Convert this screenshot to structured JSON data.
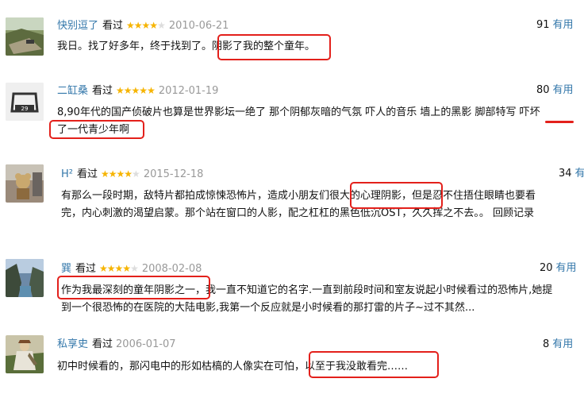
{
  "reviews": [
    {
      "user": "快别逗了",
      "watched": "看过",
      "rating": 4,
      "date": "2010-06-21",
      "useful_count": "91",
      "useful_label": "有用",
      "lines": [
        "我日。找了好多年，终于找到了。阴影了我的整个童年。"
      ]
    },
    {
      "user": "二缸桑",
      "watched": "看过",
      "rating": 5,
      "date": "2012-01-19",
      "useful_count": "80",
      "useful_label": "有用",
      "lines": [
        "8,90年代的国产侦破片也算是世界影坛一绝了 那个阴郁灰暗的气氛 吓人的音乐 墙上的黑影 脚部特写 吓坏",
        "了一代青少年啊"
      ],
      "avatar_badge": "29"
    },
    {
      "user": "H²",
      "watched": "看过",
      "rating": 4,
      "date": "2015-12-18",
      "useful_count": "34",
      "useful_label": "有",
      "lines": [
        "有那么一段时期，敌特片都拍成惊悚恐怖片，造成小朋友们很大的心理阴影，但是忍不住捂住眼睛也要看",
        "完，内心刺激的渴望启蒙。那个站在窗口的人影，配之杠杠的黑色低沉OST，久久挥之不去。。 回顾记录"
      ]
    },
    {
      "user": "巽",
      "watched": "看过",
      "rating": 4,
      "date": "2008-02-08",
      "useful_count": "20",
      "useful_label": "有用",
      "lines": [
        "作为我最深刻的童年阴影之一，我一直不知道它的名字.一直到前段时间和室友说起小时候看过的恐怖片,她提",
        "到一个很恐怖的在医院的大陆电影,我第一个反应就是小时候看的那打雷的片子~过不其然..."
      ]
    },
    {
      "user": "私享史",
      "watched": "看过",
      "rating": 0,
      "date": "2006-01-07",
      "useful_count": "8",
      "useful_label": "有用",
      "lines": [
        "初中时候看的，那闪电中的形如枯槁的人像实在可怕，以至于我没敢看完……"
      ]
    }
  ]
}
